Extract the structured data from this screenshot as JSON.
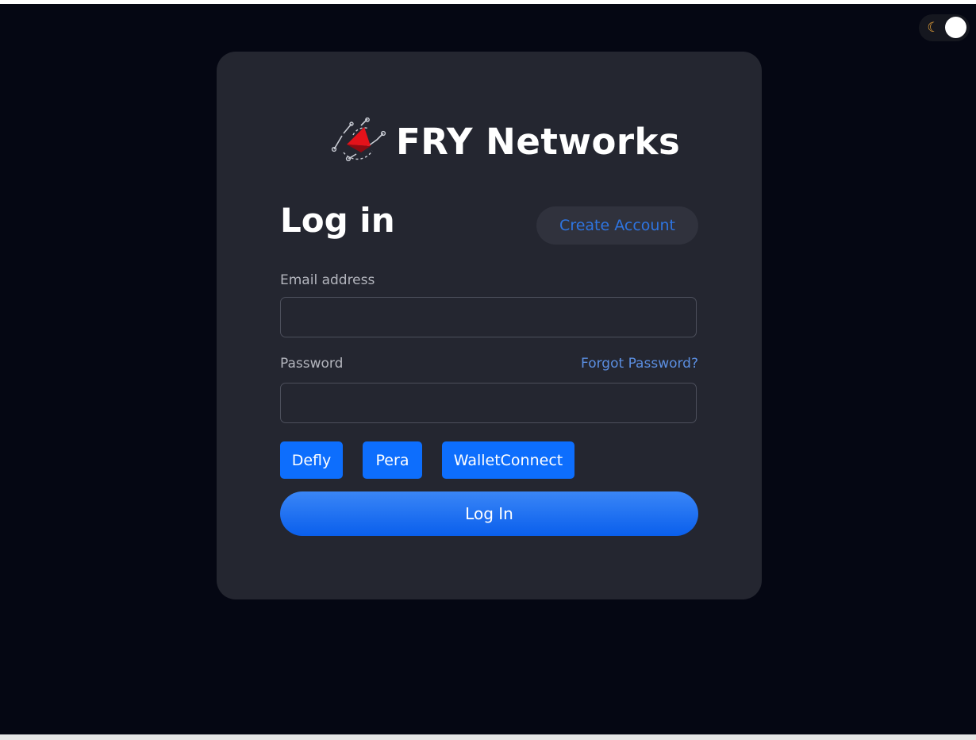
{
  "theme_toggle": {
    "mode": "dark",
    "moon_glyph": "☾",
    "accent": "#f2a93b"
  },
  "brand": {
    "name": "FRY Networks",
    "logo_icon": "fry-networks-logo-icon"
  },
  "login_form": {
    "heading": "Log in",
    "create_account_label": "Create Account",
    "email": {
      "label": "Email address",
      "value": "",
      "placeholder": ""
    },
    "password": {
      "label": "Password",
      "value": "",
      "placeholder": "",
      "forgot_label": "Forgot Password?"
    },
    "wallets": [
      {
        "label": "Defly"
      },
      {
        "label": "Pera"
      },
      {
        "label": "WalletConnect"
      }
    ],
    "submit_label": "Log In"
  },
  "colors": {
    "background": "#050713",
    "card": "#242630",
    "primary": "#0d6efd",
    "link": "#5b8ee0"
  }
}
